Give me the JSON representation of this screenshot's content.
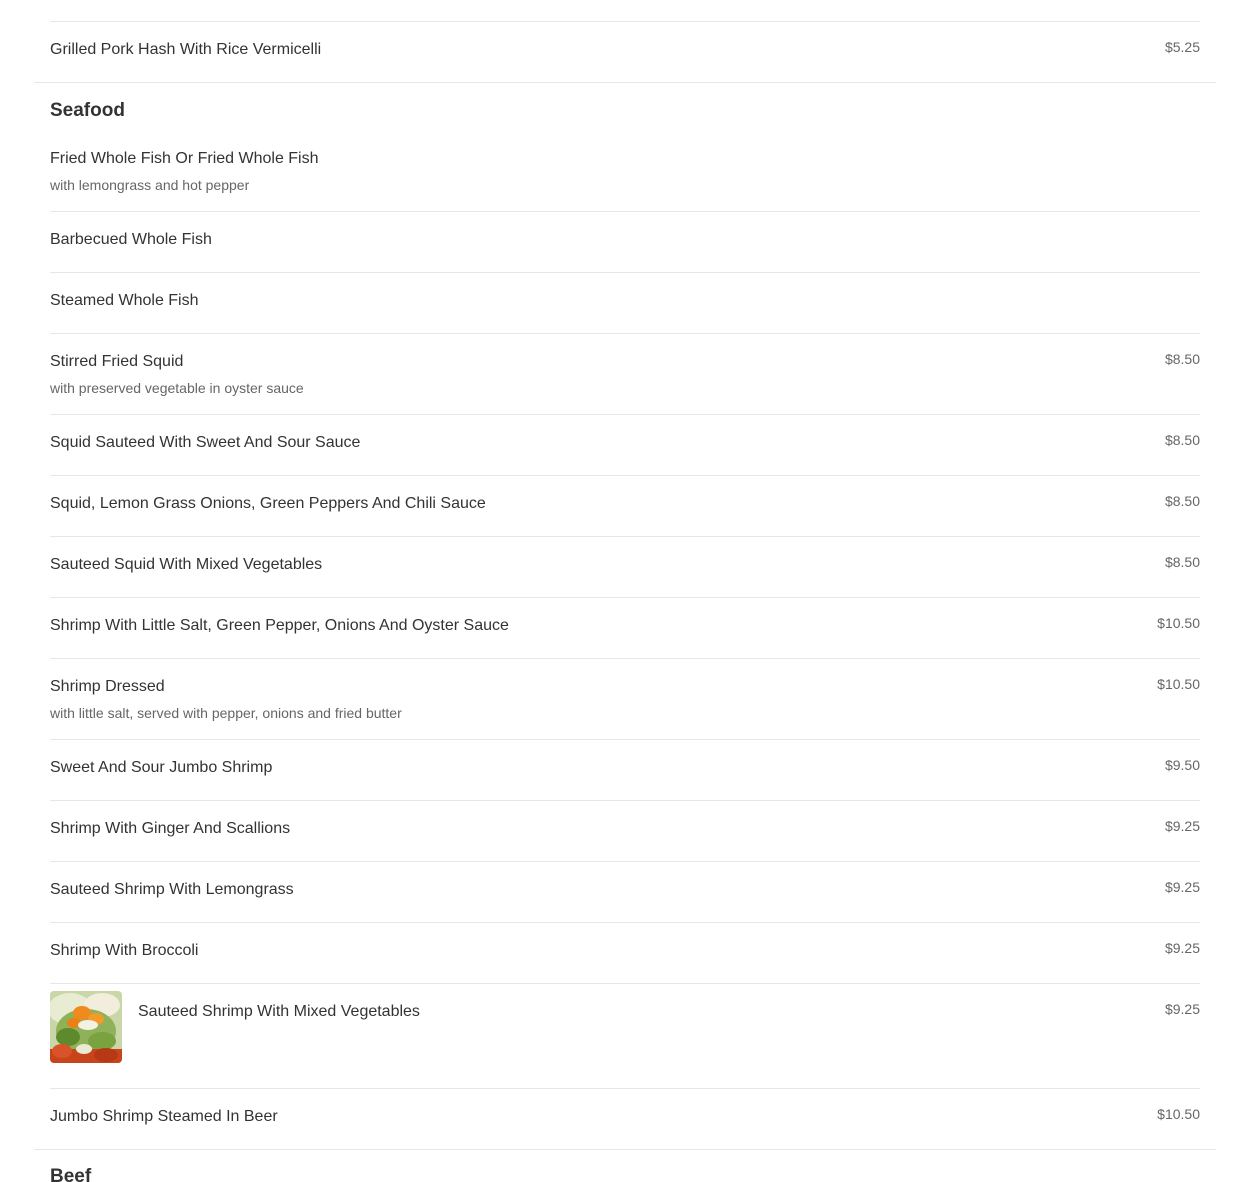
{
  "sections": {
    "pork": {
      "items": [
        {
          "name": "Grilled Pork Hash With Rice Vermicelli",
          "price": "$5.25"
        }
      ]
    },
    "seafood": {
      "title": "Seafood",
      "items": [
        {
          "name": "Fried Whole Fish Or Fried Whole Fish",
          "description": "with lemongrass and hot pepper"
        },
        {
          "name": "Barbecued Whole Fish"
        },
        {
          "name": "Steamed Whole Fish"
        },
        {
          "name": "Stirred Fried Squid",
          "description": "with preserved vegetable in oyster sauce",
          "price": "$8.50"
        },
        {
          "name": "Squid Sauteed With Sweet And Sour Sauce",
          "price": "$8.50"
        },
        {
          "name": "Squid, Lemon Grass Onions, Green Peppers And Chili Sauce",
          "price": "$8.50"
        },
        {
          "name": "Sauteed Squid With Mixed Vegetables",
          "price": "$8.50"
        },
        {
          "name": "Shrimp With Little Salt, Green Pepper, Onions And Oyster Sauce",
          "price": "$10.50"
        },
        {
          "name": "Shrimp Dressed",
          "description": "with little salt, served with pepper, onions and fried butter",
          "price": "$10.50"
        },
        {
          "name": "Sweet And Sour Jumbo Shrimp",
          "price": "$9.50"
        },
        {
          "name": "Shrimp With Ginger And Scallions",
          "price": "$9.25"
        },
        {
          "name": "Sauteed Shrimp With Lemongrass",
          "price": "$9.25"
        },
        {
          "name": "Shrimp With Broccoli",
          "price": "$9.25"
        },
        {
          "name": "Sauteed Shrimp With Mixed Vegetables",
          "price": "$9.25",
          "image": "shrimp-vegetables-photo"
        },
        {
          "name": "Jumbo Shrimp Steamed In Beer",
          "price": "$10.50"
        }
      ]
    },
    "beef": {
      "title": "Beef"
    }
  }
}
